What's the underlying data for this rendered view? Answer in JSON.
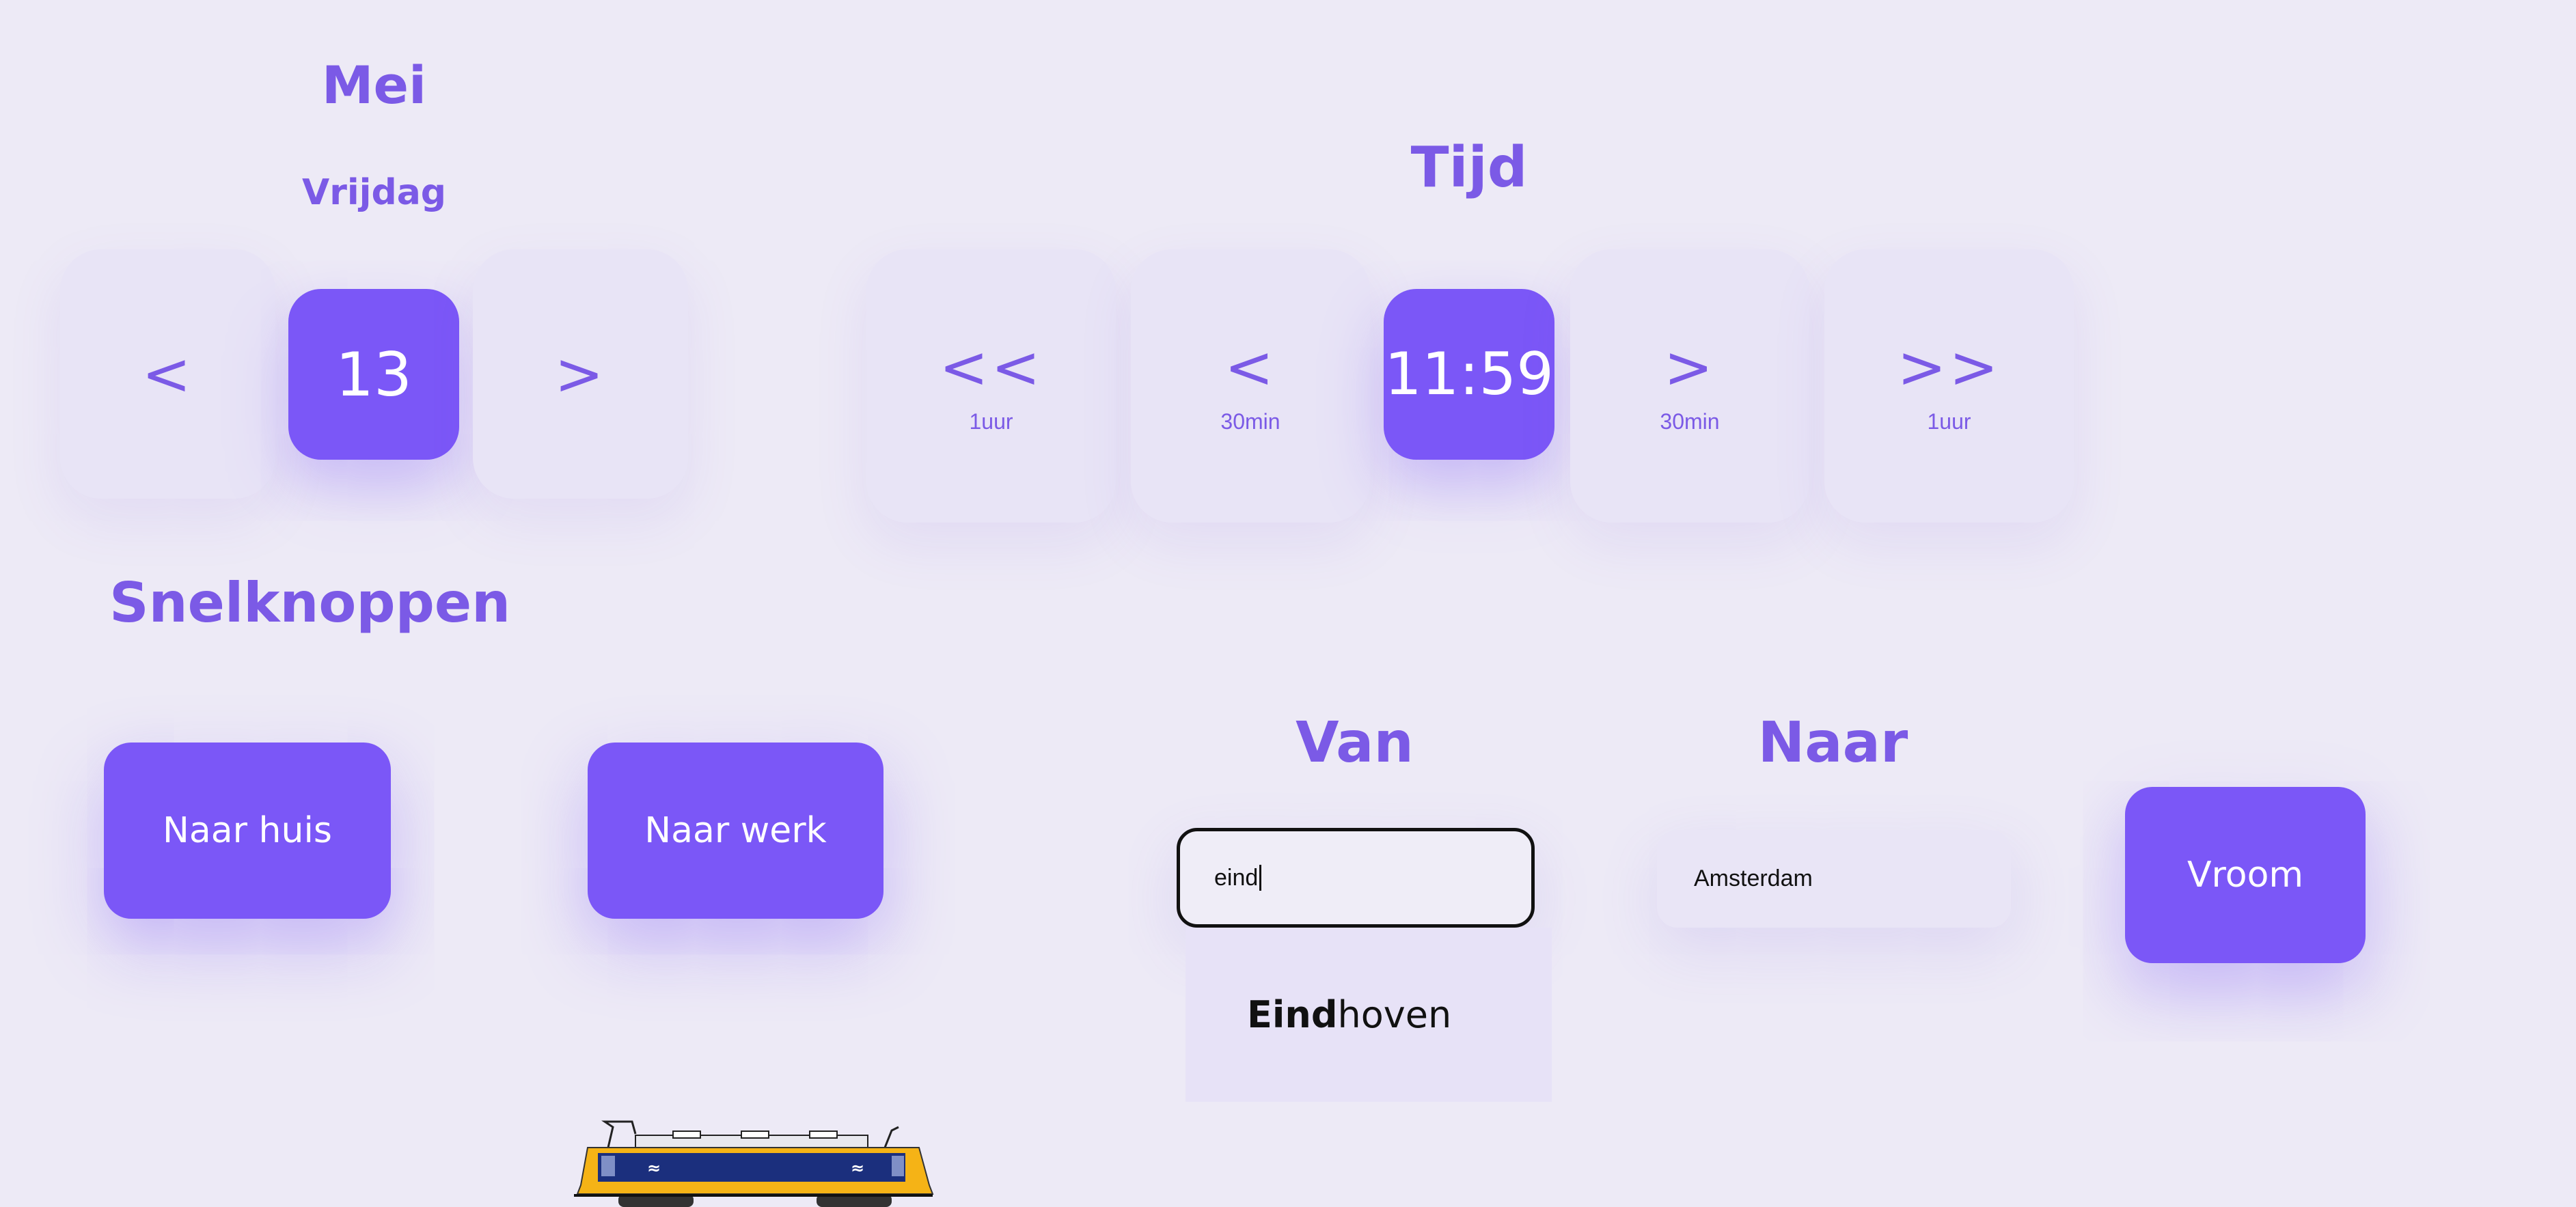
{
  "date": {
    "month": "Mei",
    "weekday": "Vrijdag",
    "prev_label": "<",
    "day": "13",
    "next_label": ">"
  },
  "time": {
    "title": "Tijd",
    "back_hour": {
      "symbol": "<<",
      "sub": "1uur"
    },
    "back_half": {
      "symbol": "<",
      "sub": "30min"
    },
    "current": "11:59",
    "fwd_half": {
      "symbol": ">",
      "sub": "30min"
    },
    "fwd_hour": {
      "symbol": ">>",
      "sub": "1uur"
    }
  },
  "shortcuts": {
    "title": "Snelknoppen",
    "home_label": "Naar huis",
    "work_label": "Naar werk"
  },
  "route": {
    "from_label": "Van",
    "from_value": "eind",
    "to_label": "Naar",
    "to_value": "Amsterdam",
    "suggestion_match": "Eind",
    "suggestion_rest": "hoven",
    "go_label": "Vroom"
  },
  "colors": {
    "accent": "#7b57f7",
    "heading": "#7b5ae6",
    "background": "#edeaf6",
    "train_yellow": "#f5b316",
    "train_blue": "#1b2f7d"
  },
  "icons": [
    "train-icon",
    "ns-logo-icon"
  ]
}
